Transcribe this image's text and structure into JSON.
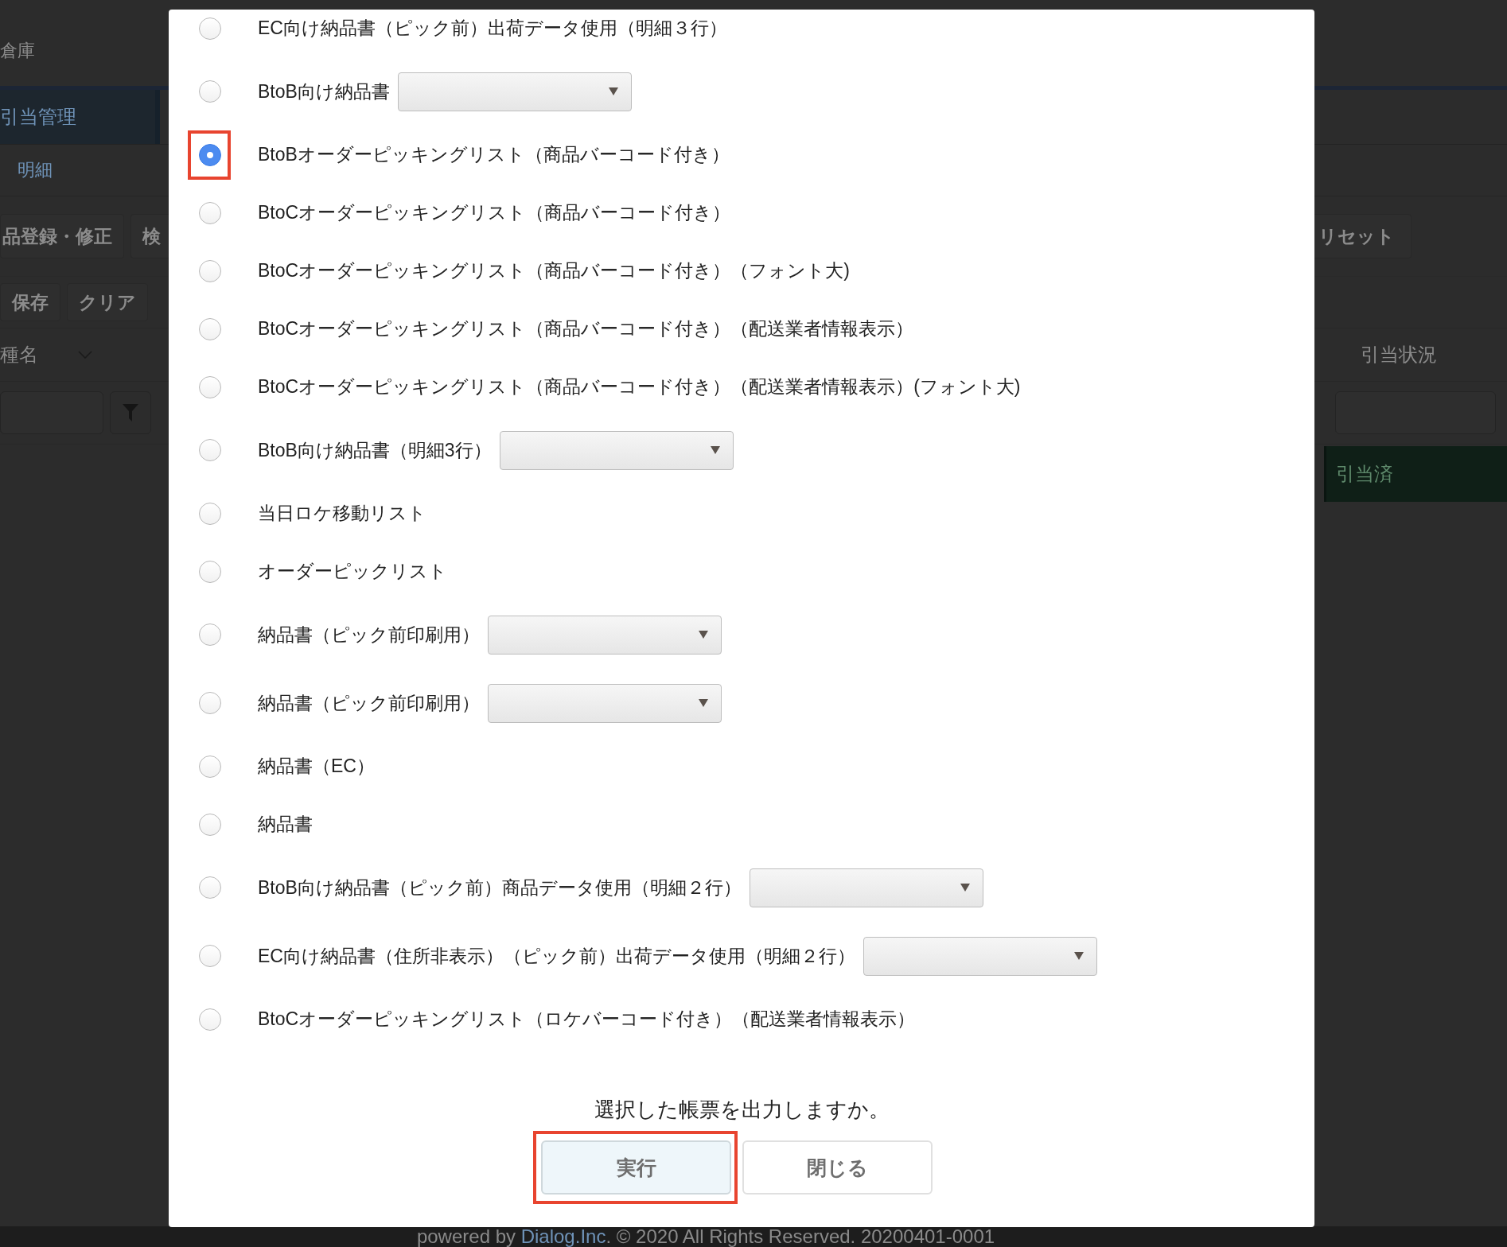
{
  "background_page": {
    "header": {
      "title": "倉庫"
    },
    "nav_tab": {
      "label": "引当管理",
      "selected": true
    },
    "sub_tab": {
      "label": "明細"
    },
    "toolbar_buttons": [
      "品登録・修正",
      "検"
    ],
    "reset_button": "リセット",
    "action_buttons": [
      "保存",
      "クリア"
    ],
    "columns": [
      {
        "label": "種名"
      },
      {
        "label": "引当状況"
      }
    ],
    "rows": [
      {
        "allocation_status": "引当済"
      }
    ]
  },
  "dialog": {
    "options": [
      {
        "label": "EC向け納品書（ピック前）出荷データ使用（明細３行）",
        "kind": "plain",
        "selected": false,
        "highlighted": false
      },
      {
        "label": "BtoB向け納品書",
        "kind": "dropdown",
        "selected": false,
        "highlighted": false
      },
      {
        "label": "BtoBオーダーピッキングリスト（商品バーコード付き）",
        "kind": "plain",
        "selected": true,
        "highlighted": true
      },
      {
        "label": "BtoCオーダーピッキングリスト（商品バーコード付き）",
        "kind": "plain",
        "selected": false,
        "highlighted": false
      },
      {
        "label": "BtoCオーダーピッキングリスト（商品バーコード付き）（フォント大)",
        "kind": "plain",
        "selected": false,
        "highlighted": false
      },
      {
        "label": "BtoCオーダーピッキングリスト（商品バーコード付き）（配送業者情報表示）",
        "kind": "plain",
        "selected": false,
        "highlighted": false
      },
      {
        "label": "BtoCオーダーピッキングリスト（商品バーコード付き）（配送業者情報表示）(フォント大)",
        "kind": "plain",
        "selected": false,
        "highlighted": false
      },
      {
        "label": "BtoB向け納品書（明細3行）",
        "kind": "dropdown",
        "selected": false,
        "highlighted": false
      },
      {
        "label": "当日ロケ移動リスト",
        "kind": "plain",
        "selected": false,
        "highlighted": false
      },
      {
        "label": "オーダーピックリスト",
        "kind": "plain",
        "selected": false,
        "highlighted": false
      },
      {
        "label": "納品書（ピック前印刷用）",
        "kind": "dropdown",
        "selected": false,
        "highlighted": false
      },
      {
        "label": "納品書（ピック前印刷用）",
        "kind": "dropdown",
        "selected": false,
        "highlighted": false
      },
      {
        "label": "納品書（EC）",
        "kind": "plain",
        "selected": false,
        "highlighted": false
      },
      {
        "label": "納品書",
        "kind": "plain",
        "selected": false,
        "highlighted": false
      },
      {
        "label": "BtoB向け納品書（ピック前）商品データ使用（明細２行）",
        "kind": "dropdown",
        "selected": false,
        "highlighted": false
      },
      {
        "label": "EC向け納品書（住所非表示）（ピック前）出荷データ使用（明細２行）",
        "kind": "dropdown",
        "selected": false,
        "highlighted": false
      },
      {
        "label": "BtoCオーダーピッキングリスト（ロケバーコード付き）（配送業者情報表示）",
        "kind": "plain",
        "selected": false,
        "highlighted": false
      }
    ],
    "question": "選択した帳票を出力しますか。",
    "buttons": [
      {
        "label": "実行",
        "kind": "primary",
        "highlighted": true
      },
      {
        "label": "閉じる",
        "kind": "secondary",
        "highlighted": false
      }
    ]
  },
  "footer": {
    "text_before": "powered by ",
    "link": "Dialog.Inc",
    "text_after": ". © 2020 All Rights Reserved. 20200401-0001"
  }
}
